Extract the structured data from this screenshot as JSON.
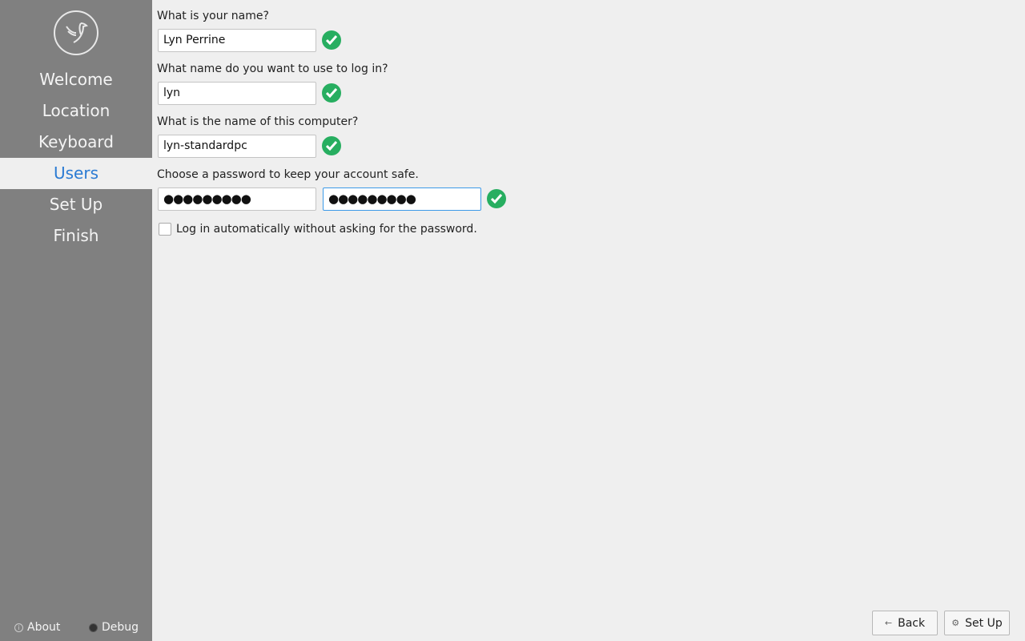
{
  "sidebar": {
    "items": [
      {
        "label": "Welcome"
      },
      {
        "label": "Location"
      },
      {
        "label": "Keyboard"
      },
      {
        "label": "Users",
        "selected": true
      },
      {
        "label": "Set Up"
      },
      {
        "label": "Finish"
      }
    ],
    "about": "About",
    "debug": "Debug",
    "logo_icon": "bird-logo-icon"
  },
  "form": {
    "name_label": "What is your name?",
    "name_value": "Lyn Perrine",
    "login_label": "What name do you want to use to log in?",
    "login_value": "lyn",
    "host_label": "What is the name of this computer?",
    "host_value": "lyn-standardpc",
    "password_label": "Choose a password to keep your account safe.",
    "password_value": "●●●●●●●●●",
    "password_confirm_value": "●●●●●●●●●",
    "autologin_label": "Log in automatically without asking for the password.",
    "autologin_checked": false,
    "valid_color": "#27ae60"
  },
  "buttons": {
    "back": "Back",
    "setup": "Set Up"
  },
  "colors": {
    "sidebar": "#808080",
    "accent": "#2b7bd3"
  }
}
